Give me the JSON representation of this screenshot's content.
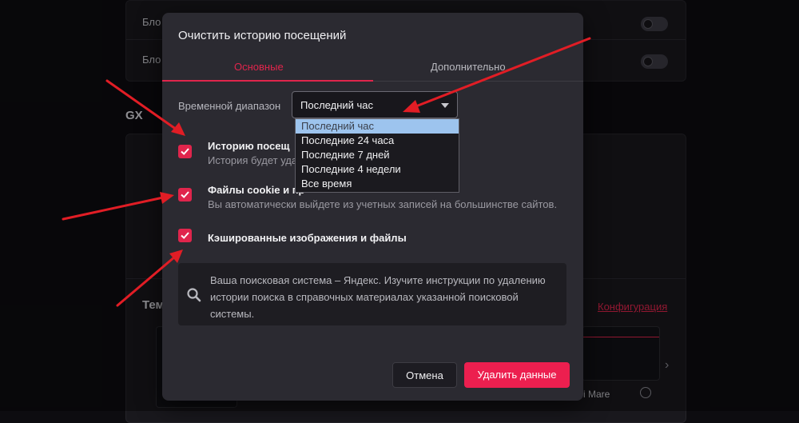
{
  "background": {
    "rows": [
      {
        "label": "Бло"
      },
      {
        "label": "Бло"
      }
    ],
    "gx_heading": "GX",
    "section_heading": "Тем",
    "config_link": "Конфигурация",
    "theme_label": "i Mare"
  },
  "dialog": {
    "title": "Очистить историю посещений",
    "tabs": [
      {
        "label": "Основные",
        "active": true
      },
      {
        "label": "Дополнительно",
        "active": false
      }
    ],
    "time_range": {
      "label": "Временной диапазон",
      "selected": "Последний час",
      "options": [
        "Последний час",
        "Последние 24 часа",
        "Последние 7 дней",
        "Последние 4 недели",
        "Все время"
      ]
    },
    "options": [
      {
        "title": "Историю посещений",
        "title_visible": "Историю посещ",
        "subtitle": "История будет уда",
        "checked": true
      },
      {
        "title": "Файлы cookie и прочие данные сайтов",
        "title_visible": "Файлы cookie и пр",
        "subtitle": "Вы автоматически выйдете из учетных записей на большинстве сайтов.",
        "checked": true
      },
      {
        "title": "Кэшированные изображения и файлы",
        "subtitle": "",
        "checked": true
      }
    ],
    "info_text": "Ваша поисковая система – Яндекс. Изучите инструкции по удалению истории поиска в справочных материалах указанной поисковой системы.",
    "buttons": {
      "cancel": "Отмена",
      "delete": "Удалить данные"
    }
  },
  "colors": {
    "accent": "#e0254c",
    "delete_button": "#ec1f4f",
    "dialog_bg": "#2b2a31",
    "page_bg": "#0d0c10",
    "selected_option": "#9dc4ee",
    "arrow": "#e11d25"
  },
  "icons": {
    "checkbox": "check-icon",
    "info": "search-icon",
    "select": "caret-down-icon",
    "carousel": "chevron-right-icon"
  }
}
